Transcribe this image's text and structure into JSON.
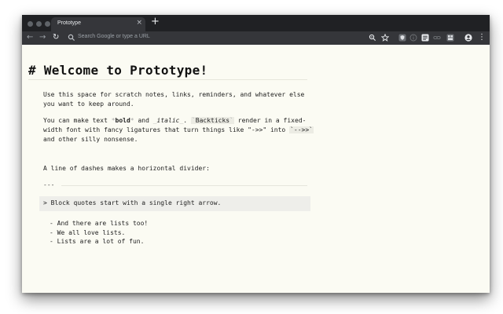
{
  "browser": {
    "tab_title": "Prototype",
    "tab_close": "×",
    "new_tab": "+",
    "omnibox_placeholder": "Search Google or type a URL",
    "back": "←",
    "forward": "→",
    "reload": "↻",
    "menu": "⋮"
  },
  "note": {
    "heading": "# Welcome to Prototype!",
    "p1": [
      "Use this space for scratch notes, links, reminders, and whatever else",
      "you want to keep around."
    ],
    "p2": {
      "l1_a": "You can make text ",
      "bold_mark_open": "*",
      "bold_word": "bold",
      "bold_mark_close": "*",
      "l1_b": " and ",
      "italic_mark_open": "_",
      "italic_word": "italic",
      "italic_mark_close": "_",
      "l1_c": ". ",
      "bt_open": "`",
      "backticks_word": "Backticks",
      "bt_close": "`",
      "l1_d": " render in a fixed-",
      "l2_a": "width font with fancy ligatures that turn things like \"->>\" into ",
      "code2": "`-->>`",
      "l3": "and other silly nonsense."
    },
    "p3": "A line of dashes makes a horizontal divider:",
    "divider": "---",
    "blockquote": "> Block quotes start with a single right arrow.",
    "list": [
      "- And there are lists too!",
      "- We all love lists.",
      "- Lists are a lot of fun."
    ]
  }
}
